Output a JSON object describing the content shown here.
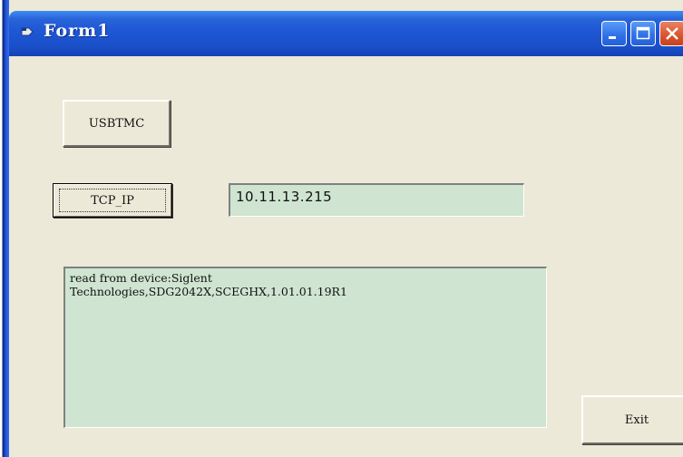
{
  "window": {
    "title": "Form1",
    "title_icon": "app-form-icon",
    "controls": {
      "minimize": "minimize-icon",
      "maximize": "maximize-icon",
      "close": "close-icon"
    },
    "colors": {
      "titlebar": "#1e56d4",
      "client_bg": "#ece9d8",
      "field_bg": "#cfe5d1"
    }
  },
  "buttons": {
    "usbtmc_label": "USBTMC",
    "tcpip_label": "TCP_IP",
    "exit_label": "Exit"
  },
  "fields": {
    "ip_address": "10.11.13.215",
    "output_text": "read from device:Siglent\nTechnologies,SDG2042X,SCEGHX,1.01.01.19R1"
  }
}
